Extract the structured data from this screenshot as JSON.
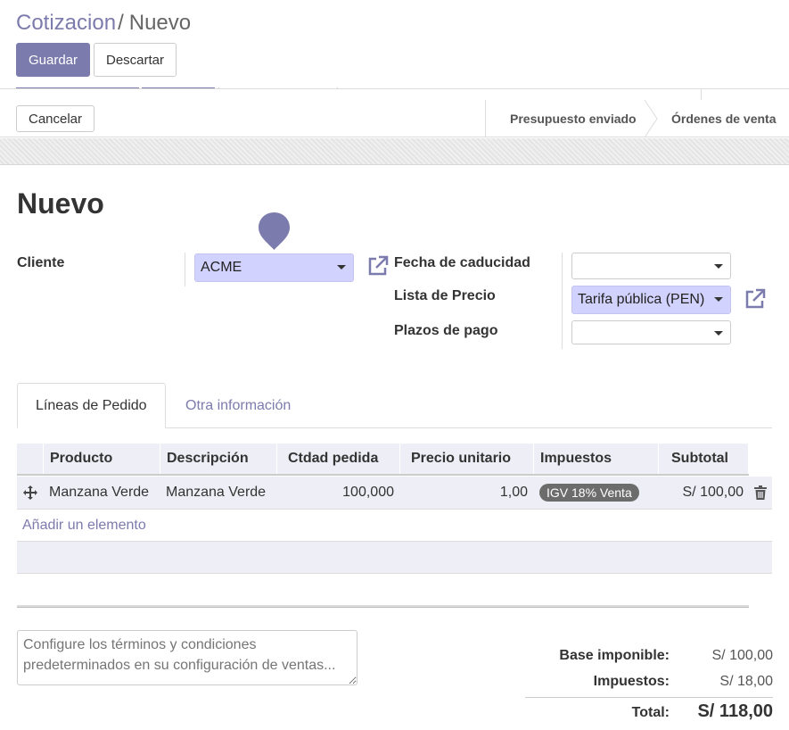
{
  "breadcrumb": {
    "parent": "Cotizacion",
    "separator": "/",
    "current": "Nuevo"
  },
  "toolbar": {
    "save_label": "Guardar",
    "discard_label": "Descartar"
  },
  "statusbar": {
    "cancel_label": "Cancelar",
    "stages": [
      "Presupuesto enviado",
      "Órdenes de venta"
    ]
  },
  "form": {
    "title": "Nuevo",
    "customer": {
      "label": "Cliente",
      "value": "ACME"
    },
    "expiration": {
      "label": "Fecha de caducidad",
      "value": ""
    },
    "pricelist": {
      "label": "Lista de Precio",
      "value": "Tarifa pública (PEN)"
    },
    "payment_terms": {
      "label": "Plazos de pago",
      "value": ""
    }
  },
  "tabs": [
    {
      "label": "Líneas de Pedido",
      "active": true
    },
    {
      "label": "Otra información",
      "active": false
    }
  ],
  "order_lines": {
    "columns": [
      "Producto",
      "Descripción",
      "Ctdad pedida",
      "Precio unitario",
      "Impuestos",
      "Subtotal"
    ],
    "rows": [
      {
        "product": "Manzana Verde",
        "description": "Manzana Verde",
        "qty": "100,000",
        "price": "1,00",
        "tax": "IGV 18% Venta",
        "subtotal": "S/ 100,00"
      }
    ],
    "add_line": "Añadir un elemento"
  },
  "note": {
    "placeholder": "Configure los términos y condiciones predeterminados en su configuración de ventas..."
  },
  "totals": {
    "untaxed_label": "Base imponible:",
    "untaxed_value": "S/ 100,00",
    "taxes_label": "Impuestos:",
    "taxes_value": "S/ 18,00",
    "total_label": "Total:",
    "total_value": "S/ 118,00"
  },
  "colors": {
    "accent": "#7c7bad",
    "required_field": "#d2d2ff",
    "table_bg": "#eeeef6",
    "badge": "#6c6c6c"
  },
  "icons": [
    "external-link-icon",
    "move-handle-icon",
    "trash-icon",
    "map-pin-icon",
    "caret-down-icon"
  ]
}
